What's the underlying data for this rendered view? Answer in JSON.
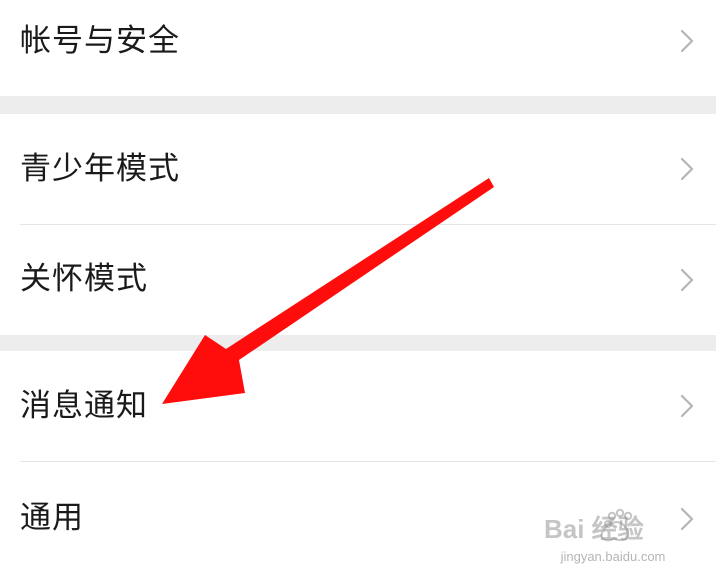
{
  "settings": {
    "items": [
      {
        "label": "帐号与安全"
      },
      {
        "label": "青少年模式"
      },
      {
        "label": "关怀模式"
      },
      {
        "label": "消息通知"
      },
      {
        "label": "通用"
      }
    ]
  },
  "watermark": {
    "brand": "Bai 经验",
    "url": "jingyan.baidu.com"
  },
  "colors": {
    "background": "#ededed",
    "row": "#ffffff",
    "text": "#1a1a1a",
    "chevron": "#b5b5b5",
    "arrow": "#ff0d0d"
  },
  "icons": {
    "row_chevron": "chevron-right-icon",
    "annotation": "red-pointer-arrow",
    "watermark": "baidu-paw-logo"
  }
}
